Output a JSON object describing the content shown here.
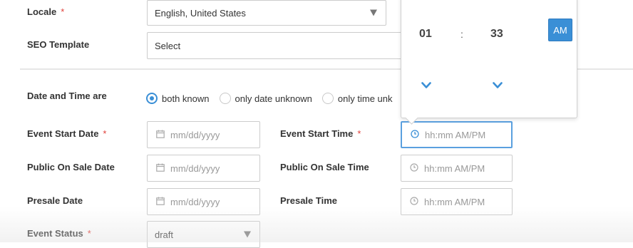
{
  "form": {
    "locale": {
      "label": "Locale",
      "required": "*",
      "value": "English, United States"
    },
    "seo_template": {
      "label": "SEO Template",
      "value": "Select"
    },
    "date_time_are": {
      "label": "Date and Time are",
      "options": [
        {
          "label": "both known",
          "checked": true
        },
        {
          "label": "only date unknown",
          "checked": false
        },
        {
          "label": "only time unk",
          "checked": false
        }
      ]
    },
    "event_start_date": {
      "label": "Event Start Date",
      "required": "*",
      "placeholder": "mm/dd/yyyy"
    },
    "event_start_time": {
      "label": "Event Start Time",
      "required": "*",
      "placeholder": "hh:mm AM/PM"
    },
    "public_on_sale_date": {
      "label": "Public On Sale Date",
      "placeholder": "mm/dd/yyyy"
    },
    "public_on_sale_time": {
      "label": "Public On Sale Time",
      "placeholder": "hh:mm AM/PM"
    },
    "presale_date": {
      "label": "Presale Date",
      "placeholder": "mm/dd/yyyy"
    },
    "presale_time": {
      "label": "Presale Time",
      "placeholder": "hh:mm AM/PM"
    },
    "event_status": {
      "label": "Event Status",
      "required": "*",
      "value": "draft"
    }
  },
  "time_picker": {
    "hour": "01",
    "separator": ":",
    "minute": "33",
    "meridiem": "AM"
  },
  "colors": {
    "accent": "#3a8fd6",
    "required": "#e0403a"
  }
}
